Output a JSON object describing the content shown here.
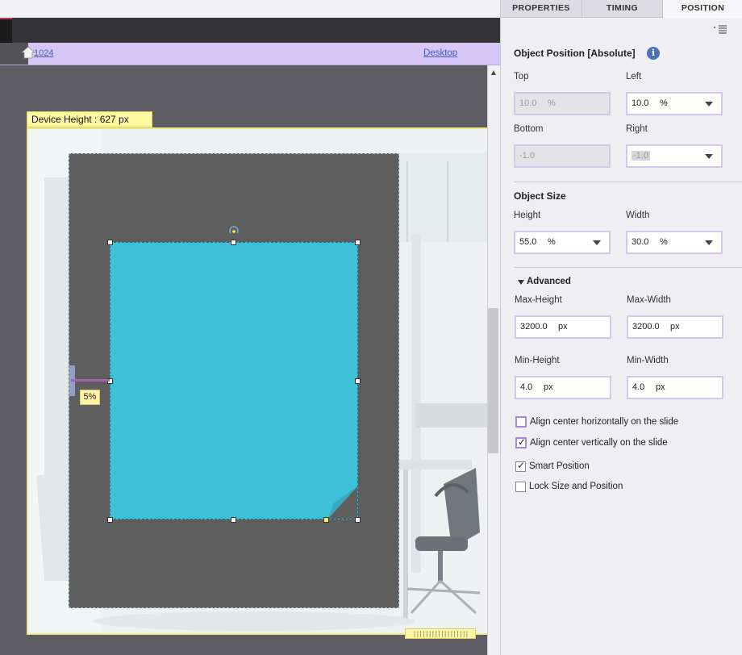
{
  "canvas": {
    "breakpoint_width_link": "1024",
    "breakpoint_name_link": "Desktop",
    "device_height_label": "Device Height : 627 px",
    "left_offset_tag": "5%",
    "grip_glyphs": "||||||||||||||||||"
  },
  "panel": {
    "tabs": [
      {
        "label": "PROPERTIES",
        "active": false
      },
      {
        "label": "TIMING",
        "active": false
      },
      {
        "label": "POSITION",
        "active": true
      }
    ],
    "object_position": {
      "title": "Object Position [Absolute]",
      "info_glyph": "i",
      "top": {
        "label": "Top",
        "value": "10.0",
        "unit": "%",
        "disabled": true
      },
      "left": {
        "label": "Left",
        "value": "10.0",
        "unit": "%"
      },
      "bottom": {
        "label": "Bottom",
        "value": "-1.0",
        "disabled": true
      },
      "right": {
        "label": "Right",
        "value": "-1.0",
        "disabled": true
      }
    },
    "object_size": {
      "title": "Object Size",
      "height": {
        "label": "Height",
        "value": "55.0",
        "unit": "%"
      },
      "width": {
        "label": "Width",
        "value": "30.0",
        "unit": "%"
      }
    },
    "advanced": {
      "title": "Advanced",
      "max_height": {
        "label": "Max-Height",
        "value": "3200.0",
        "unit": "px"
      },
      "max_width": {
        "label": "Max-Width",
        "value": "3200.0",
        "unit": "px"
      },
      "min_height": {
        "label": "Min-Height",
        "value": "4.0",
        "unit": "px"
      },
      "min_width": {
        "label": "Min-Width",
        "value": "4.0",
        "unit": "px"
      }
    },
    "options": [
      {
        "label": "Align center horizontally on the slide",
        "checked": false
      },
      {
        "label": "Align center vertically on the slide",
        "checked": true
      },
      {
        "label": "Smart Position",
        "checked": true
      },
      {
        "label": "Lock Size and Position",
        "checked": false
      }
    ]
  },
  "colors": {
    "breakpoint_bar": "#d8c6f7",
    "selected_shape": "#3ec0d9",
    "field_border": "#d6c6ee",
    "info_icon": "#4b72b8"
  }
}
